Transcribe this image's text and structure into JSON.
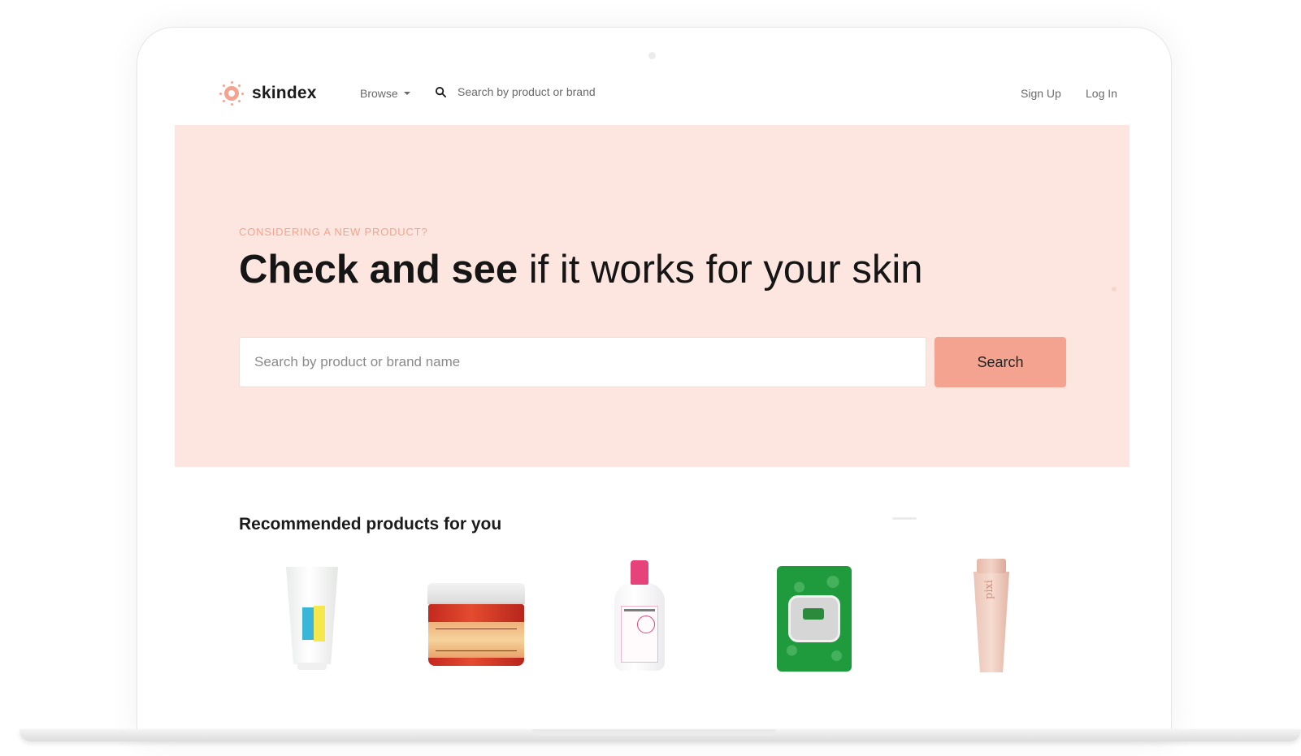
{
  "nav": {
    "brand": "skindex",
    "browse_label": "Browse",
    "search_placeholder": "Search by product or brand",
    "signup_label": "Sign Up",
    "login_label": "Log In"
  },
  "hero": {
    "eyebrow": "CONSIDERING A NEW PRODUCT?",
    "headline_bold": "Check and see",
    "headline_rest": " if it works for your skin",
    "search_placeholder": "Search by product or brand name",
    "search_button": "Search"
  },
  "recommended": {
    "title": "Recommended products for you",
    "products": [
      {
        "kind": "cleanser-tube-icon"
      },
      {
        "kind": "eye-cream-jar-icon"
      },
      {
        "kind": "micellar-water-bottle-icon"
      },
      {
        "kind": "facial-wipes-pack-icon"
      },
      {
        "kind": "pink-tube-icon",
        "brand_text": "pixi"
      }
    ]
  },
  "colors": {
    "accent": "#f3a38f",
    "hero_bg": "#fce6df",
    "text": "#151515",
    "muted": "#6a6a6a"
  }
}
